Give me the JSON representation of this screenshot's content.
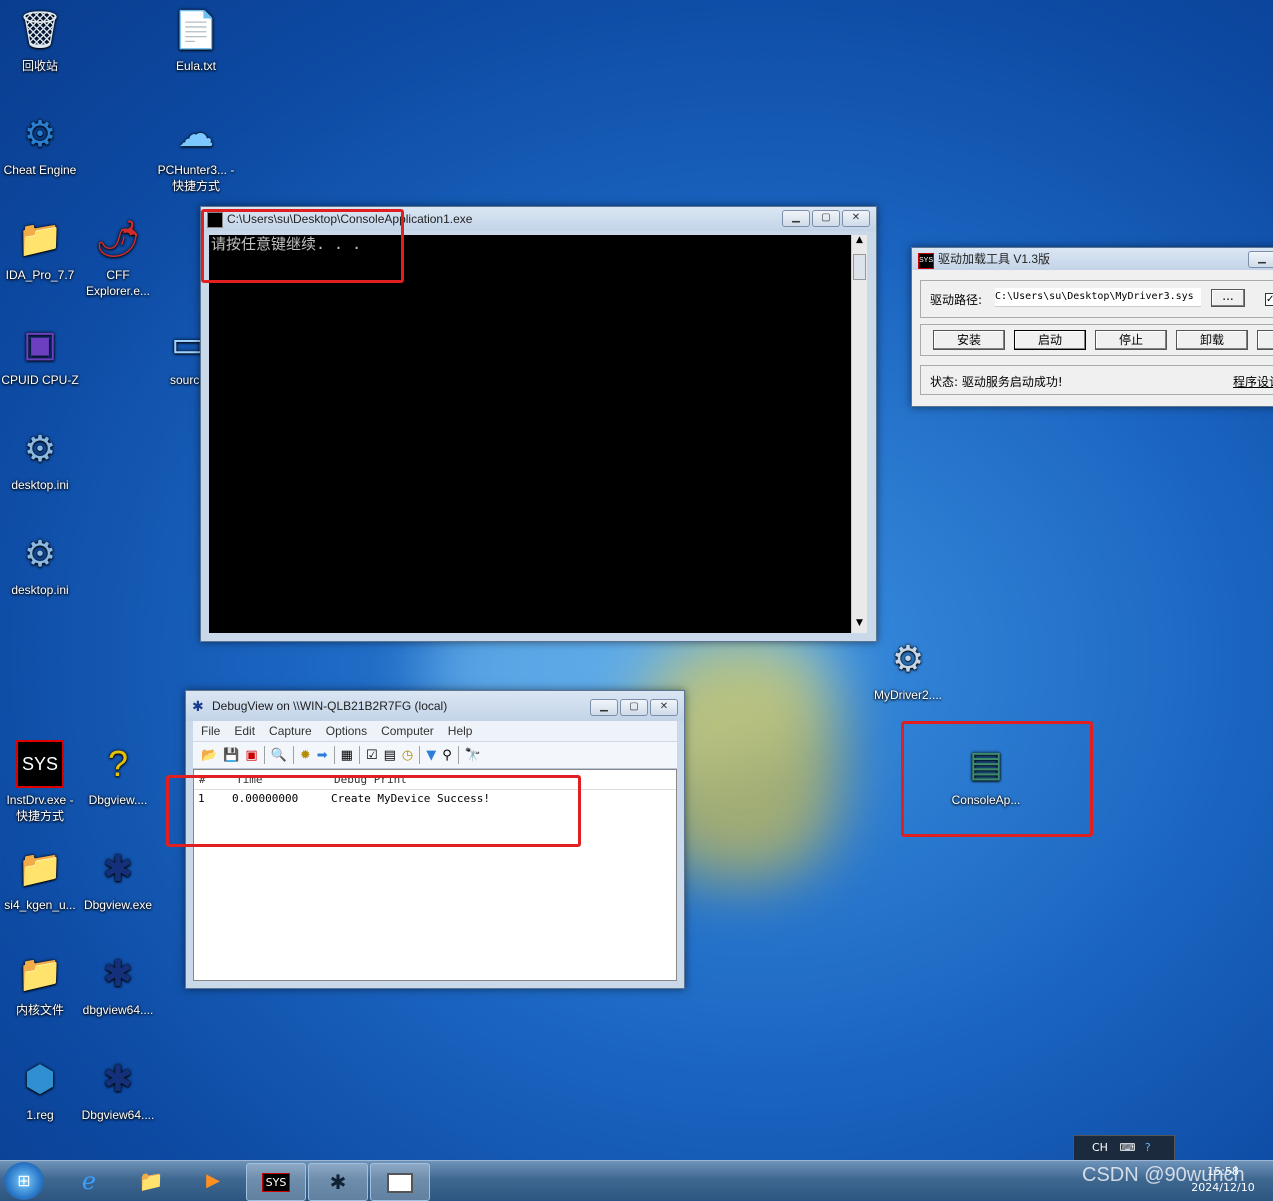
{
  "desktop": {
    "icons": [
      {
        "label": "回收站",
        "icon": "recycle-bin-icon"
      },
      {
        "label": "Eula.txt",
        "icon": "text-file-icon"
      },
      {
        "label": "Cheat Engine",
        "icon": "cheat-engine-icon"
      },
      {
        "label": "PCHunter3... - 快捷方式",
        "icon": "pchunter-icon"
      },
      {
        "label": "IDA_Pro_7.7",
        "icon": "folder-icon"
      },
      {
        "label": "CFF Explorer.e...",
        "icon": "cff-explorer-icon"
      },
      {
        "label": "CPUID CPU-Z",
        "icon": "cpuz-icon"
      },
      {
        "label": "source",
        "icon": "monitor-icon"
      },
      {
        "label": "desktop.ini",
        "icon": "ini-file-icon"
      },
      {
        "label": "desktop.ini",
        "icon": "ini-file-icon"
      },
      {
        "label": "MyDriver2....",
        "icon": "sys-file-icon"
      },
      {
        "label": "ConsoleAp...",
        "icon": "console-app-icon"
      },
      {
        "label": "InstDrv.exe - 快捷方式",
        "icon": "sys-icon"
      },
      {
        "label": "Dbgview....",
        "icon": "help-file-icon"
      },
      {
        "label": "si4_kgen_u...",
        "icon": "folder-icon"
      },
      {
        "label": "Dbgview.exe",
        "icon": "bug-icon"
      },
      {
        "label": "内核文件",
        "icon": "folder-icon"
      },
      {
        "label": "dbgview64....",
        "icon": "bug-icon"
      },
      {
        "label": "1.reg",
        "icon": "reg-file-icon"
      },
      {
        "label": "Dbgview64....",
        "icon": "bug-icon"
      }
    ]
  },
  "console": {
    "title": "C:\\Users\\su\\Desktop\\ConsoleApplication1.exe",
    "output": "请按任意键继续. . ."
  },
  "driver_tool": {
    "title": "驱动加载工具 V1.3版",
    "path_label": "驱动路径:",
    "path_value": "C:\\Users\\su\\Desktop\\MyDriver3.sys",
    "browse": "...",
    "buttons": [
      "安装",
      "启动",
      "停止",
      "卸载"
    ],
    "status": "状态: 驱动服务启动成功!",
    "settings": "程序设计"
  },
  "debugview": {
    "title": "DebugView on \\\\WIN-QLB21B2R7FG (local)",
    "menu": [
      "File",
      "Edit",
      "Capture",
      "Options",
      "Computer",
      "Help"
    ],
    "columns": [
      "#",
      "Time",
      "Debug Print"
    ],
    "rows": [
      {
        "num": "1",
        "time": "0.00000000",
        "text": "Create MyDevice Success!"
      }
    ]
  },
  "tray": {
    "lang": "CH",
    "time": "15:58",
    "date": "2024/12/10"
  },
  "watermark": "CSDN @90wunch"
}
